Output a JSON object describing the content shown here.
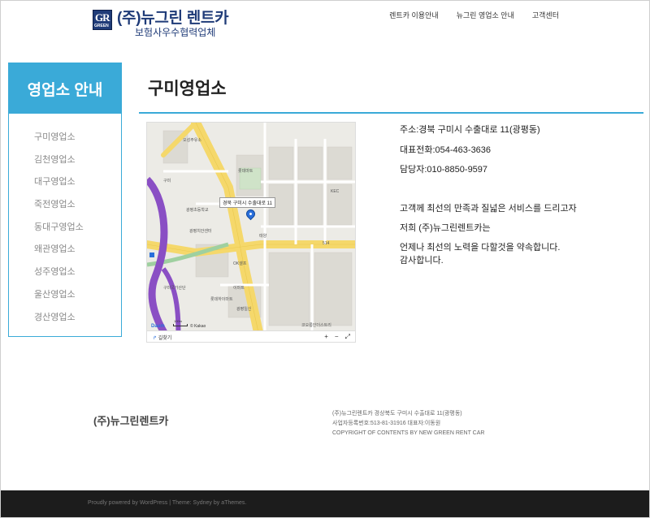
{
  "header": {
    "logo_badge": "GR",
    "logo_badge_sub": "GREEN",
    "logo_title": "(주)뉴그린 렌트카",
    "logo_subtitle": "보험사우수협력업체",
    "nav": [
      "렌트카 이용안내",
      "뉴그린 영업소 안내",
      "고객센터"
    ]
  },
  "sidebar": {
    "title": "영업소 안내",
    "items": [
      "구미영업소",
      "김천영업소",
      "대구영업소",
      "죽전영업소",
      "동대구영업소",
      "왜관영업소",
      "성주영업소",
      "울산영업소",
      "경산영업소"
    ]
  },
  "main": {
    "title": "구미영업소",
    "address": "주소:경북 구미시 수출대로 11(광평동)",
    "phone": "대표전화:054-463-3636",
    "manager": "담당자:010-8850-9597",
    "message_lines": [
      "고객께 최선의 만족과 질넓은 서비스를 드리고자",
      "저희 (주)뉴그린렌트카는",
      "언제나 최선의 노력을 다할것을 약속합니다.",
      "감사합니다."
    ]
  },
  "map": {
    "callout": "경북 구미시 수출대로 11",
    "find_label": "길찾기",
    "zoom_in": "+",
    "zoom_out": "−",
    "fullscreen": "⤢",
    "copyright": "© Kakao",
    "scale": "100m",
    "logo": "Daum",
    "labels": [
      "오성주유소",
      "롯데마트",
      "KEC",
      "광평초등학교",
      "광평치안센터",
      "구미",
      "OK셀프",
      "이마트",
      "롯데하이마트",
      "광평일신",
      "코오롱인더스트리",
      "태양",
      "514",
      "구미국가산단"
    ]
  },
  "footer": {
    "company": "(주)뉴그린렌트카",
    "info_lines": [
      "(주)뉴그린렌트카 경상북도 구미시 수출대로 11(광평동)",
      "사업자등록번호:513-81-31916 대표자:이동원",
      "COPYRIGHT OF CONTENTS BY NEW GREEN RENT CAR"
    ],
    "powered": "Proudly powered by WordPress | Theme: Sydney by aThemes."
  },
  "colors": {
    "accent": "#3aaad8",
    "brand": "#1f3b78",
    "footer_bg": "#1c1c1c"
  }
}
